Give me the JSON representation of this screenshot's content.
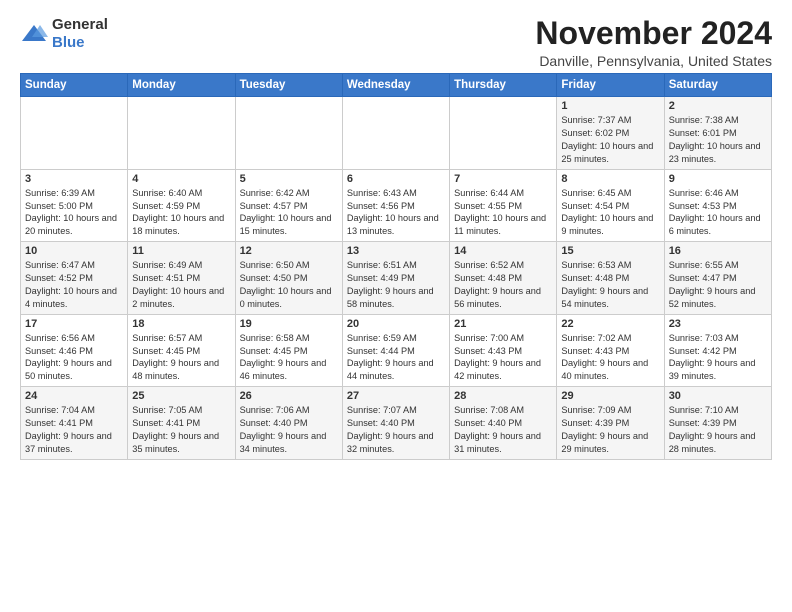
{
  "logo": {
    "general": "General",
    "blue": "Blue"
  },
  "title": "November 2024",
  "location": "Danville, Pennsylvania, United States",
  "days_of_week": [
    "Sunday",
    "Monday",
    "Tuesday",
    "Wednesday",
    "Thursday",
    "Friday",
    "Saturday"
  ],
  "weeks": [
    [
      {
        "day": "",
        "info": ""
      },
      {
        "day": "",
        "info": ""
      },
      {
        "day": "",
        "info": ""
      },
      {
        "day": "",
        "info": ""
      },
      {
        "day": "",
        "info": ""
      },
      {
        "day": "1",
        "info": "Sunrise: 7:37 AM\nSunset: 6:02 PM\nDaylight: 10 hours and 25 minutes."
      },
      {
        "day": "2",
        "info": "Sunrise: 7:38 AM\nSunset: 6:01 PM\nDaylight: 10 hours and 23 minutes."
      }
    ],
    [
      {
        "day": "3",
        "info": "Sunrise: 6:39 AM\nSunset: 5:00 PM\nDaylight: 10 hours and 20 minutes."
      },
      {
        "day": "4",
        "info": "Sunrise: 6:40 AM\nSunset: 4:59 PM\nDaylight: 10 hours and 18 minutes."
      },
      {
        "day": "5",
        "info": "Sunrise: 6:42 AM\nSunset: 4:57 PM\nDaylight: 10 hours and 15 minutes."
      },
      {
        "day": "6",
        "info": "Sunrise: 6:43 AM\nSunset: 4:56 PM\nDaylight: 10 hours and 13 minutes."
      },
      {
        "day": "7",
        "info": "Sunrise: 6:44 AM\nSunset: 4:55 PM\nDaylight: 10 hours and 11 minutes."
      },
      {
        "day": "8",
        "info": "Sunrise: 6:45 AM\nSunset: 4:54 PM\nDaylight: 10 hours and 9 minutes."
      },
      {
        "day": "9",
        "info": "Sunrise: 6:46 AM\nSunset: 4:53 PM\nDaylight: 10 hours and 6 minutes."
      }
    ],
    [
      {
        "day": "10",
        "info": "Sunrise: 6:47 AM\nSunset: 4:52 PM\nDaylight: 10 hours and 4 minutes."
      },
      {
        "day": "11",
        "info": "Sunrise: 6:49 AM\nSunset: 4:51 PM\nDaylight: 10 hours and 2 minutes."
      },
      {
        "day": "12",
        "info": "Sunrise: 6:50 AM\nSunset: 4:50 PM\nDaylight: 10 hours and 0 minutes."
      },
      {
        "day": "13",
        "info": "Sunrise: 6:51 AM\nSunset: 4:49 PM\nDaylight: 9 hours and 58 minutes."
      },
      {
        "day": "14",
        "info": "Sunrise: 6:52 AM\nSunset: 4:48 PM\nDaylight: 9 hours and 56 minutes."
      },
      {
        "day": "15",
        "info": "Sunrise: 6:53 AM\nSunset: 4:48 PM\nDaylight: 9 hours and 54 minutes."
      },
      {
        "day": "16",
        "info": "Sunrise: 6:55 AM\nSunset: 4:47 PM\nDaylight: 9 hours and 52 minutes."
      }
    ],
    [
      {
        "day": "17",
        "info": "Sunrise: 6:56 AM\nSunset: 4:46 PM\nDaylight: 9 hours and 50 minutes."
      },
      {
        "day": "18",
        "info": "Sunrise: 6:57 AM\nSunset: 4:45 PM\nDaylight: 9 hours and 48 minutes."
      },
      {
        "day": "19",
        "info": "Sunrise: 6:58 AM\nSunset: 4:45 PM\nDaylight: 9 hours and 46 minutes."
      },
      {
        "day": "20",
        "info": "Sunrise: 6:59 AM\nSunset: 4:44 PM\nDaylight: 9 hours and 44 minutes."
      },
      {
        "day": "21",
        "info": "Sunrise: 7:00 AM\nSunset: 4:43 PM\nDaylight: 9 hours and 42 minutes."
      },
      {
        "day": "22",
        "info": "Sunrise: 7:02 AM\nSunset: 4:43 PM\nDaylight: 9 hours and 40 minutes."
      },
      {
        "day": "23",
        "info": "Sunrise: 7:03 AM\nSunset: 4:42 PM\nDaylight: 9 hours and 39 minutes."
      }
    ],
    [
      {
        "day": "24",
        "info": "Sunrise: 7:04 AM\nSunset: 4:41 PM\nDaylight: 9 hours and 37 minutes."
      },
      {
        "day": "25",
        "info": "Sunrise: 7:05 AM\nSunset: 4:41 PM\nDaylight: 9 hours and 35 minutes."
      },
      {
        "day": "26",
        "info": "Sunrise: 7:06 AM\nSunset: 4:40 PM\nDaylight: 9 hours and 34 minutes."
      },
      {
        "day": "27",
        "info": "Sunrise: 7:07 AM\nSunset: 4:40 PM\nDaylight: 9 hours and 32 minutes."
      },
      {
        "day": "28",
        "info": "Sunrise: 7:08 AM\nSunset: 4:40 PM\nDaylight: 9 hours and 31 minutes."
      },
      {
        "day": "29",
        "info": "Sunrise: 7:09 AM\nSunset: 4:39 PM\nDaylight: 9 hours and 29 minutes."
      },
      {
        "day": "30",
        "info": "Sunrise: 7:10 AM\nSunset: 4:39 PM\nDaylight: 9 hours and 28 minutes."
      }
    ]
  ]
}
